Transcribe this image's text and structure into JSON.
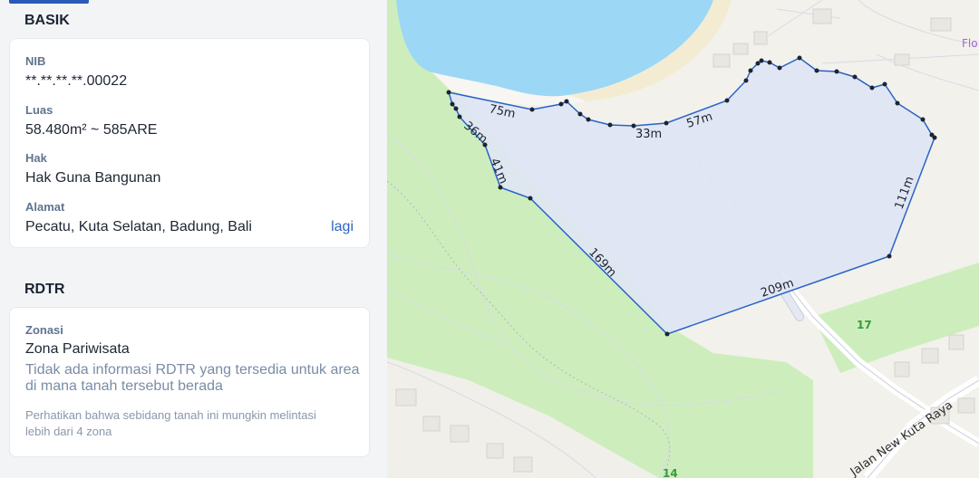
{
  "basik": {
    "title": "BASIK",
    "nib_label": "NIB",
    "nib_value": "**.**.**.**.00022",
    "luas_label": "Luas",
    "luas_value": "58.480m² ~ 585ARE",
    "hak_label": "Hak",
    "hak_value": "Hak Guna Bangunan",
    "alamat_label": "Alamat",
    "alamat_value": "Pecatu, Kuta Selatan, Badung, Bali",
    "more_link": "lagi"
  },
  "rdtr": {
    "title": "RDTR",
    "zonasi_label": "Zonasi",
    "zonasi_value": "Zona Pariwisata",
    "info_text": "Tidak ada informasi RDTR yang tersedia untuk area di mana tanah tersebut berada",
    "note_text": "Perhatikan bahwa sebidang tanah ini mungkin melintasi lebih dari 4 zona"
  },
  "map": {
    "measurements": [
      "75m",
      "36m",
      "41m",
      "169m",
      "33m",
      "57m",
      "111m",
      "209m"
    ],
    "zone_labels": [
      "17",
      "14"
    ],
    "road_label": "Jalan New Kuta Raya",
    "poi_label": "Flo",
    "colors": {
      "water": "#9cd8f5",
      "park": "#cdeebc",
      "parcel_fill": "#dfe5f4",
      "parcel_stroke": "#2a63c6",
      "sand": "#f4ecd2"
    }
  }
}
